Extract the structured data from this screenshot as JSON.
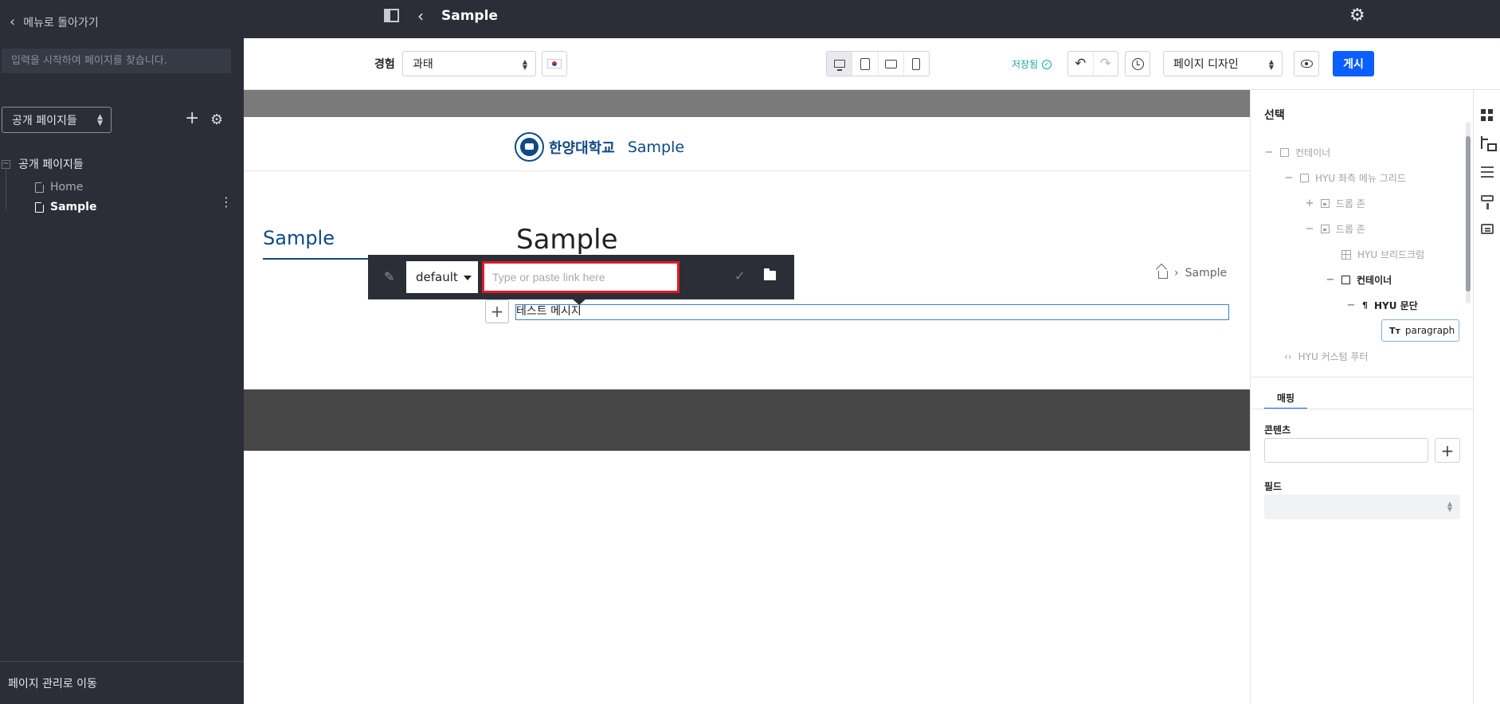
{
  "sidebar": {
    "back_label": "메뉴로 돌아가기",
    "search_placeholder": "입력을 시작하여 페이지를 찾습니다.",
    "visibility_select": "공개 페이지들",
    "tree_root": "공개 페이지들",
    "pages": [
      {
        "label": "Home",
        "active": false
      },
      {
        "label": "Sample",
        "active": true
      }
    ],
    "footer_link": "페이지 관리로 이동"
  },
  "topbar": {
    "title": "Sample"
  },
  "toolbar": {
    "experience_label": "경험",
    "experience_value": "과태",
    "save_status": "저장됨",
    "mode_value": "페이지 디자인",
    "publish_label": "게시",
    "devices": [
      "desktop",
      "tablet",
      "tablet-landscape",
      "phone"
    ],
    "active_device": "desktop"
  },
  "canvas": {
    "logo_text": "한양대학교",
    "site_name": "Sample",
    "left_nav_title": "Sample",
    "heading": "Sample",
    "breadcrumb": "Sample",
    "paragraph_text": "테스트 메시지",
    "link_toolbar": {
      "style_value": "default",
      "url_placeholder": "Type or paste link here",
      "url_value": ""
    }
  },
  "right_panel": {
    "title": "선택",
    "layers": {
      "container_root": "컨테이너",
      "left_menu_grid": "HYU 좌측 메뉴 그리드",
      "drop_zone_1": "드롭 존",
      "drop_zone_2": "드롭 존",
      "breadcrumb": "HYU 브리드크럼",
      "container": "컨테이너",
      "paragraph_component": "HYU 문단",
      "paragraph": "paragraph",
      "footer": "HYU 커스텀 푸터"
    },
    "tab": "매핑",
    "content_label": "콘텐츠",
    "field_label": "필드"
  },
  "colors": {
    "sidebar_bg": "#2b2e37",
    "brand_blue": "#0e4a84",
    "primary": "#0b5fff",
    "saved_green": "#1aa39a",
    "highlight_red": "#e11a24"
  }
}
